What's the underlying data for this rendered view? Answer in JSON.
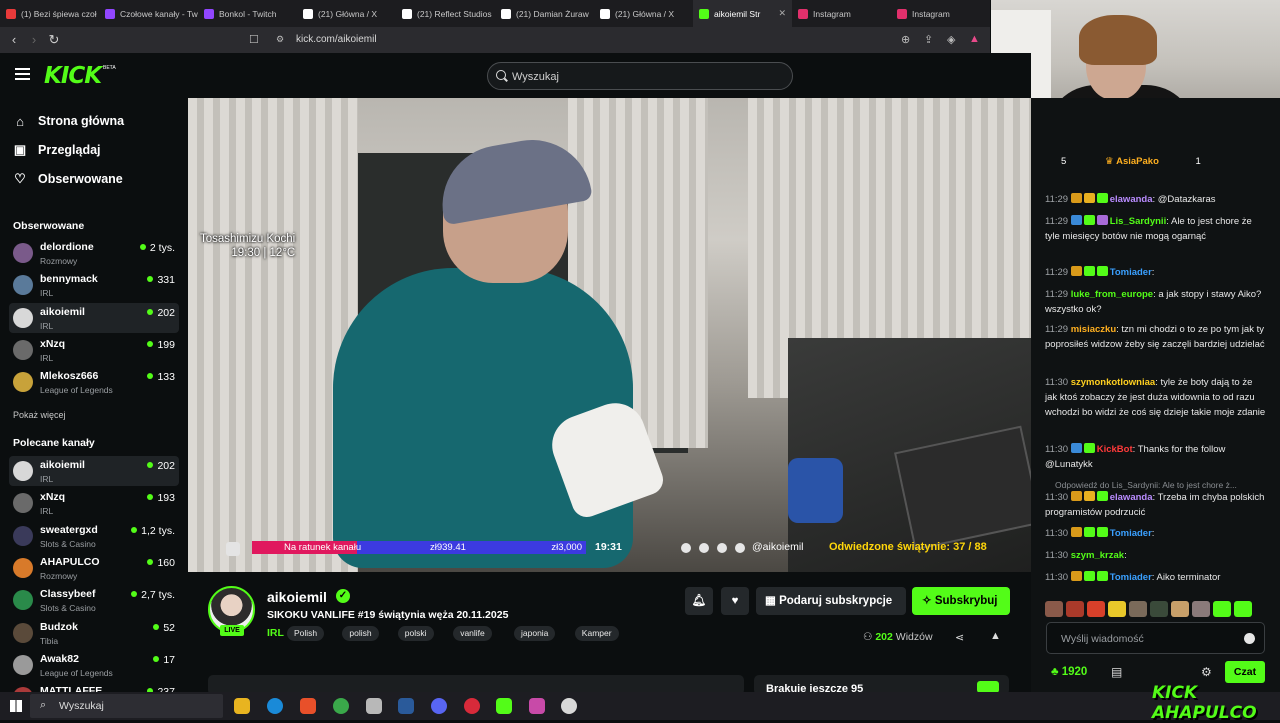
{
  "browser": {
    "tabs": [
      {
        "label": "(1) Bezi śpiewa czoł",
        "color": "#e83a3a"
      },
      {
        "label": "Czołowe kanały - Tw",
        "color": "#9146ff"
      },
      {
        "label": "Bonkol - Twitch",
        "color": "#9146ff"
      },
      {
        "label": "(21) Główna / X",
        "color": "#ffffff"
      },
      {
        "label": "(21) Reflect Studios",
        "color": "#ffffff"
      },
      {
        "label": "(21) Damian Żuraw",
        "color": "#ffffff"
      },
      {
        "label": "(21) Główna / X",
        "color": "#ffffff"
      },
      {
        "label": "aikoiemil Str",
        "color": "#53fc18"
      },
      {
        "label": "Instagram",
        "color": "#e1306c"
      },
      {
        "label": "Instagram",
        "color": "#e1306c"
      }
    ],
    "url": "kick.com/aikoiemil"
  },
  "header": {
    "logo": "KICK",
    "logo_tag": "BETA",
    "search_placeholder": "Wyszukaj"
  },
  "sidebar": {
    "nav": [
      {
        "label": "Strona główna",
        "icon": "home-icon"
      },
      {
        "label": "Przeglądaj",
        "icon": "browse-icon"
      },
      {
        "label": "Obserwowane",
        "icon": "heart-icon"
      }
    ],
    "following_title": "Obserwowane",
    "following": [
      {
        "name": "delordione",
        "category": "Rozmowy",
        "viewers": "2 tys.",
        "color": "#7a5a8a"
      },
      {
        "name": "bennymack",
        "category": "IRL",
        "viewers": "331",
        "color": "#5a7a9a"
      },
      {
        "name": "aikoiemil",
        "category": "IRL",
        "viewers": "202",
        "color": "#d8d8d8"
      },
      {
        "name": "xNzq",
        "category": "IRL",
        "viewers": "199",
        "color": "#6a6a6a"
      },
      {
        "name": "Mlekosz666",
        "category": "League of Legends",
        "viewers": "133",
        "color": "#c8a23a"
      }
    ],
    "show_more": "Pokaż więcej",
    "recommended_title": "Polecane kanały",
    "recommended": [
      {
        "name": "aikoiemil",
        "category": "IRL",
        "viewers": "202",
        "color": "#d8d8d8"
      },
      {
        "name": "xNzq",
        "category": "IRL",
        "viewers": "193",
        "color": "#6a6a6a"
      },
      {
        "name": "sweatergxd",
        "category": "Slots & Casino",
        "viewers": "1,2 tys.",
        "color": "#3a3a5a"
      },
      {
        "name": "AHAPULCO",
        "category": "Rozmowy",
        "viewers": "160",
        "color": "#d87a2a"
      },
      {
        "name": "Classybeef",
        "category": "Slots & Casino",
        "viewers": "2,7 tys.",
        "color": "#2a8a4a"
      },
      {
        "name": "Budzok",
        "category": "Tibia",
        "viewers": "52",
        "color": "#5a4a3a"
      },
      {
        "name": "Awak82",
        "category": "League of Legends",
        "viewers": "17",
        "color": "#9a9a9a"
      },
      {
        "name": "MATTLAFFE",
        "category": "",
        "viewers": "237",
        "color": "#aa3a3a"
      }
    ]
  },
  "video": {
    "location_line1": "Tosashimizu Kochi",
    "location_line2": "19:30 | 12°C",
    "goal_label": "Na ratunek kanału",
    "goal_current": "zł939.41",
    "goal_max": "zł3,000",
    "goal_fraction": 0.313,
    "time": "19:31",
    "handle": "@aikoiemil",
    "temples": "Odwiedzone świątynie: 37 / 88"
  },
  "channel": {
    "name": "aikoiemil",
    "live_label": "LIVE",
    "title": "SIKOKU VANLIFE #19 świątynia węża 20.11.2025",
    "category": "IRL",
    "tags": [
      "Polish",
      "polish",
      "polski",
      "vanlife",
      "japonia",
      "Kamper"
    ],
    "gift_label": "Podaruj subskrypcje",
    "subscribe_label": "Subskrybuj",
    "viewers_count": "202",
    "viewers_label": "Widzów",
    "card_text": "Brakuje jeszcze 95"
  },
  "chat": {
    "pinned_count": "5",
    "pinned_user": "AsiaPako",
    "pinned_extra": "1",
    "messages": [
      {
        "time": "11:29",
        "user": "elawanda",
        "color": "#b98cff",
        "text": "@Datazkaras",
        "badges": [
          "#d99a1a",
          "#e8b020",
          "#53fc18"
        ]
      },
      {
        "time": "11:29",
        "user": "Lis_Sardynii",
        "color": "#53fc18",
        "text": "Ale to jest chore że tyle miesięcy botów nie mogą ogarnąć",
        "badges": [
          "#3a8ad8",
          "#53fc18",
          "#a86ad8"
        ]
      },
      {
        "time": "11:29",
        "user": "Tomiader",
        "color": "#3aa0ff",
        "text": "",
        "badges": [
          "#d99a1a",
          "#53fc18",
          "#53fc18"
        ]
      },
      {
        "time": "11:29",
        "user": "luke_from_europe",
        "color": "#53fc18",
        "text": "a jak stopy i stawy Aiko? wszystko ok?",
        "badges": []
      },
      {
        "time": "11:29",
        "user": "misiaczku",
        "color": "#ffb020",
        "text": "tzn mi chodzi o to ze po tym jak ty poprosiłeś widzow żeby się zaczęli bardziej udzielać",
        "badges": []
      },
      {
        "time": "11:30",
        "user": "szymonkotlowniaa",
        "color": "#ffd020",
        "text": "tyle że boty dają to że jak ktoś zobaczy że jest duża widownia to od razu wchodzi bo widzi że coś się dzieje takie moje zdanie",
        "badges": []
      },
      {
        "time": "11:30",
        "user": "KickBot",
        "color": "#ff3a3a",
        "text": "Thanks for the follow @Lunatykk",
        "badges": [
          "#3a8ad8",
          "#53fc18"
        ]
      },
      {
        "time": "11:30",
        "user": "elawanda",
        "color": "#b98cff",
        "text": "Trzeba im chyba polskich programistów podrzucić",
        "badges": [
          "#d99a1a",
          "#e8b020",
          "#53fc18"
        ]
      },
      {
        "time": "11:30",
        "user": "Tomiader",
        "color": "#3aa0ff",
        "text": "",
        "badges": [
          "#d99a1a",
          "#53fc18",
          "#53fc18"
        ]
      },
      {
        "time": "11:30",
        "user": "szym_krzak",
        "color": "#53fc18",
        "text": "",
        "badges": []
      },
      {
        "time": "11:30",
        "user": "Tomiader",
        "color": "#3aa0ff",
        "text": "Aiko terminator",
        "badges": [
          "#d99a1a",
          "#53fc18",
          "#53fc18"
        ]
      }
    ],
    "reply_text": "Odpowiedź do Lis_Sardynii: Ale to jest chore ż...",
    "input_placeholder": "Wyślij wiadomość",
    "points": "1920",
    "chat_button": "Czat"
  },
  "taskbar": {
    "search_placeholder": "Wyszukaj"
  },
  "watermark": "KICK AHAPULCO"
}
